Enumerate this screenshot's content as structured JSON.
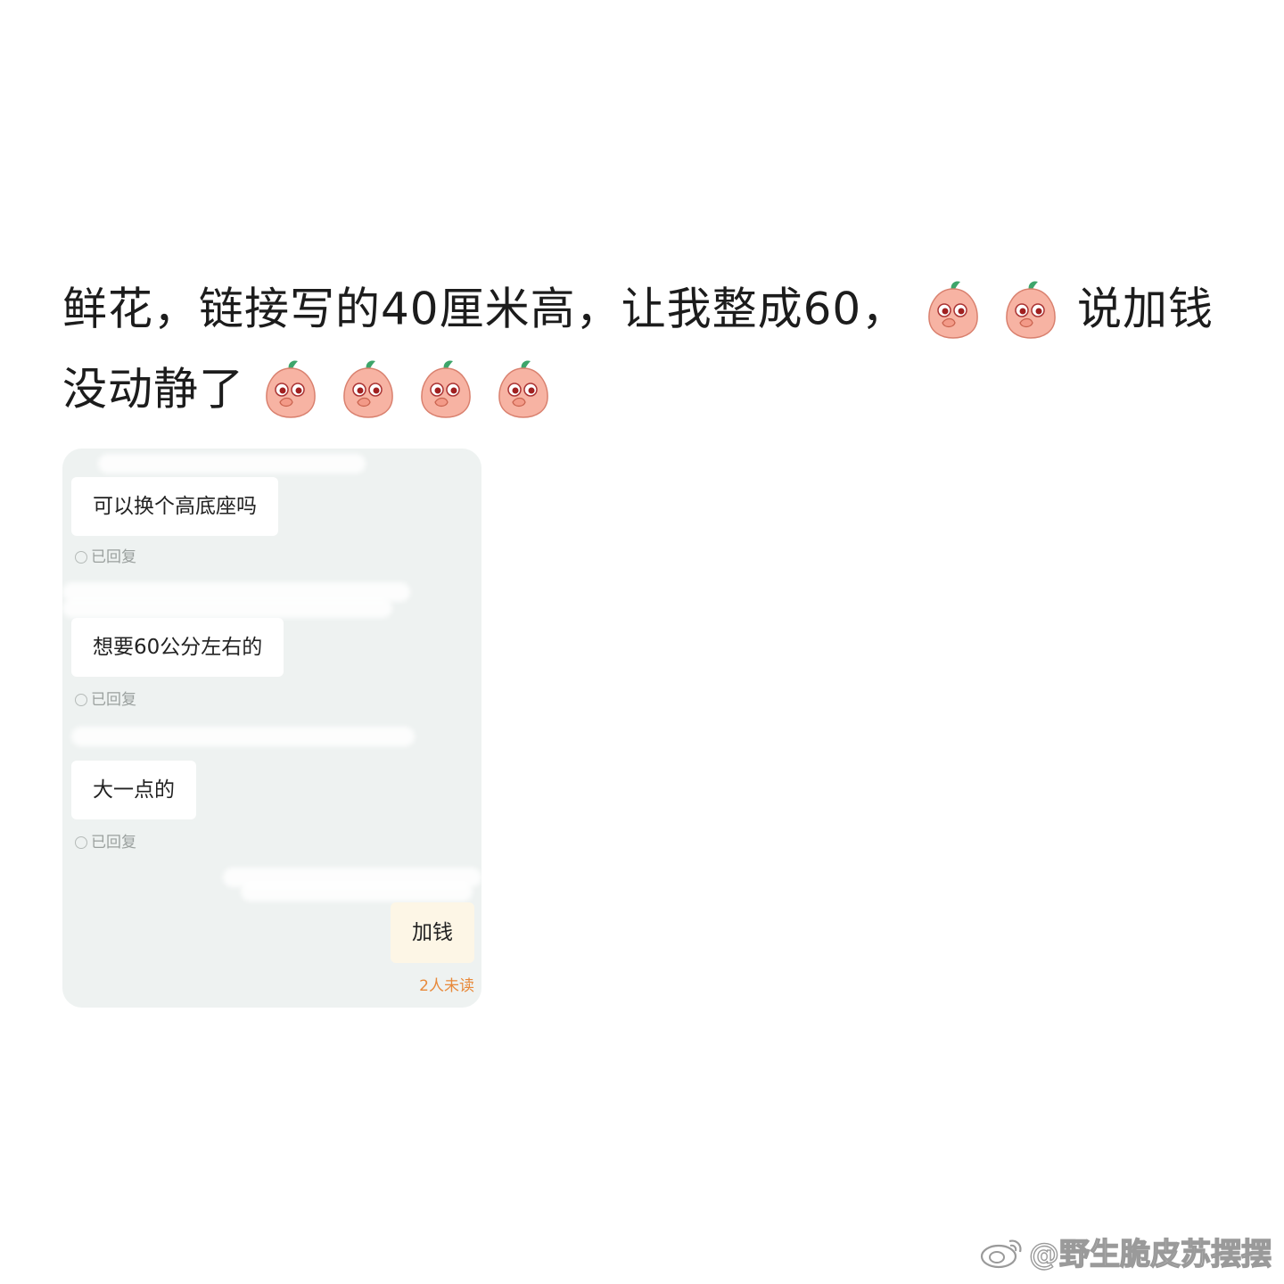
{
  "caption": {
    "part1": "鲜花，链接写的40厘米高，让我整成60，",
    "part2": "说加钱没动静了"
  },
  "emoji": {
    "name": "peach-cover-mouth-icon"
  },
  "chat": {
    "messages": [
      {
        "text": "可以换个高底座吗",
        "status": "已回复"
      },
      {
        "text": "想要60公分左右的",
        "status": "已回复"
      },
      {
        "text": "大一点的",
        "status": "已回复"
      }
    ],
    "reply": {
      "text": "加钱",
      "status": "2人未读"
    }
  },
  "watermark": "@野生脆皮苏摆摆",
  "colors": {
    "chat_bg": "#eef2f1",
    "reply_bubble": "#fdf6e6",
    "unread": "#e8893a"
  }
}
